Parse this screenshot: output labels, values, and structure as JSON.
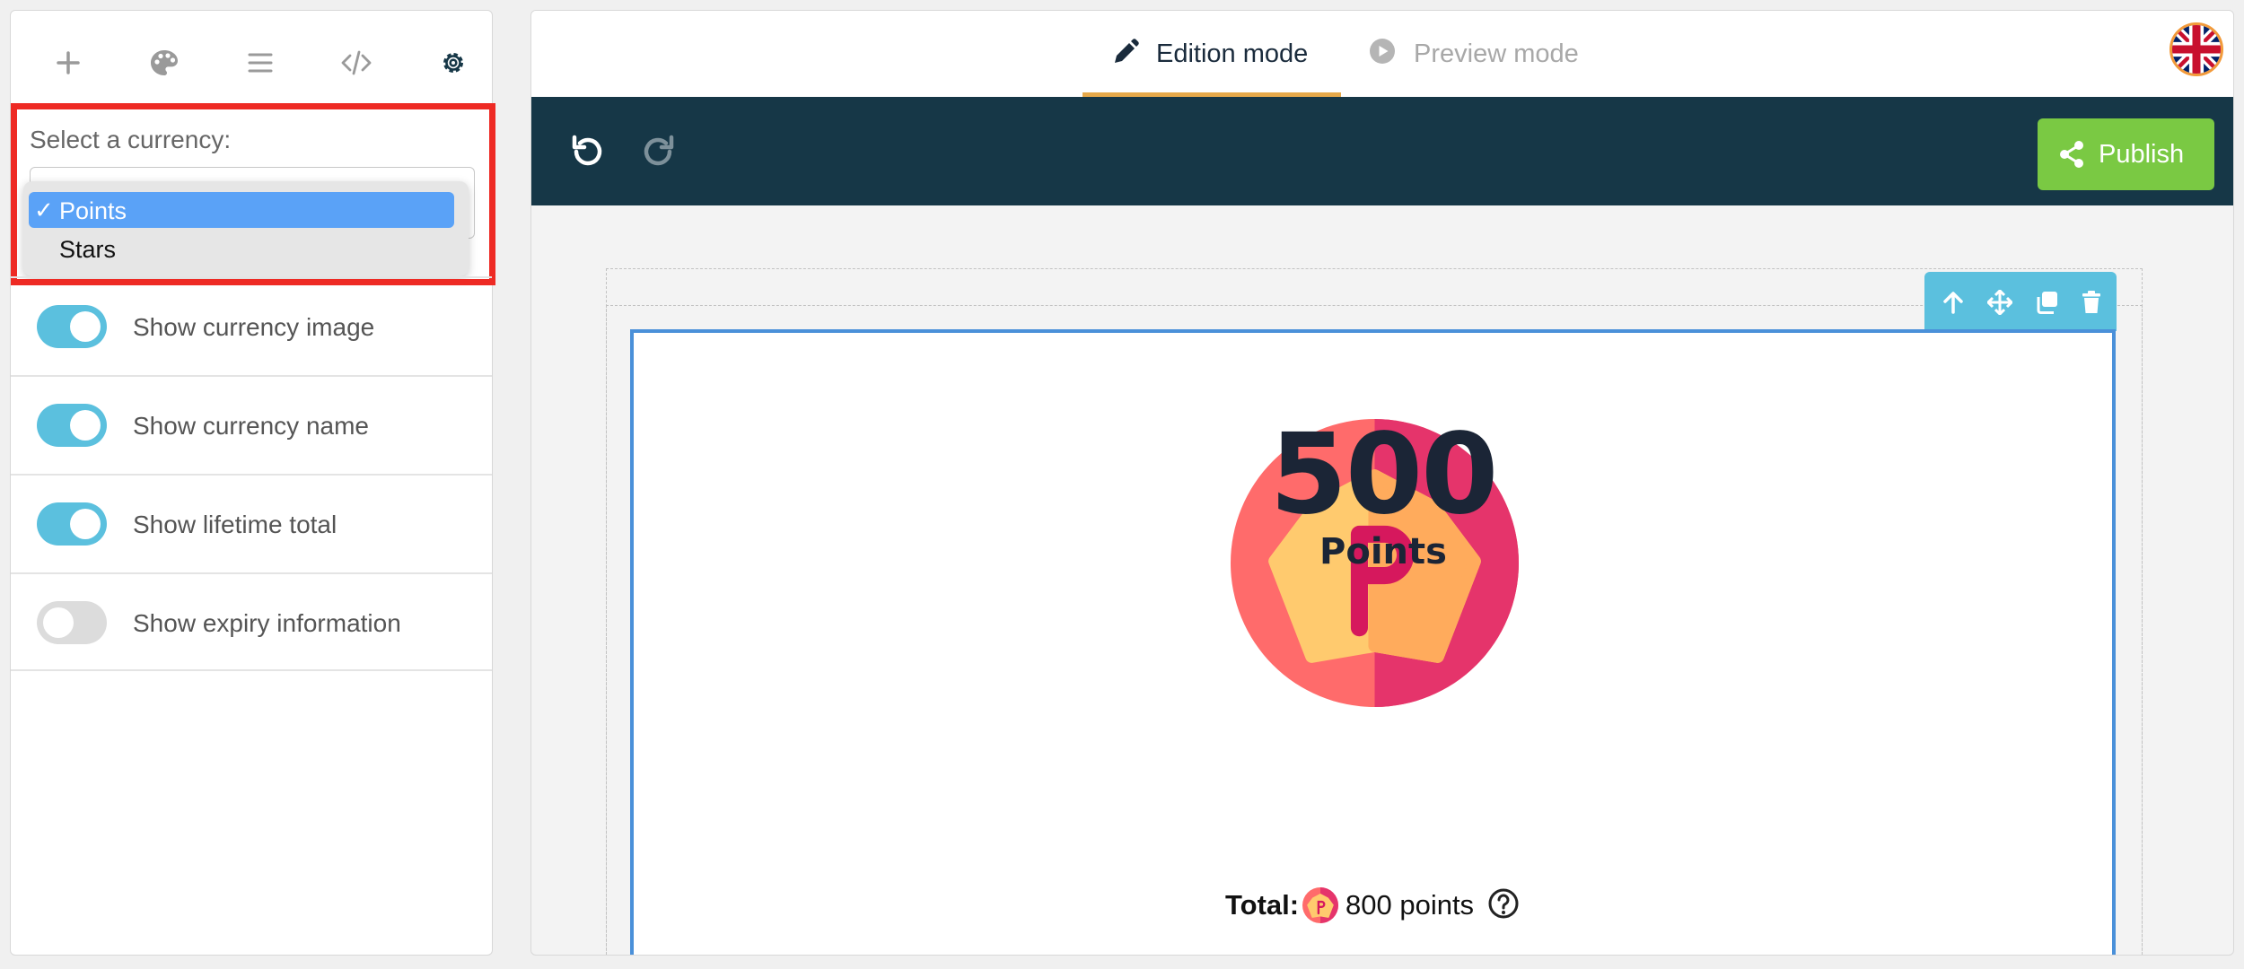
{
  "sidebar": {
    "tools": [
      {
        "icon": "plus-icon"
      },
      {
        "icon": "palette-icon"
      },
      {
        "icon": "list-icon"
      },
      {
        "icon": "code-icon"
      },
      {
        "icon": "gear-icon"
      }
    ],
    "currency_label": "Select a currency:",
    "currency_options": [
      {
        "label": "Points",
        "selected": true
      },
      {
        "label": "Stars",
        "selected": false
      }
    ],
    "toggles": [
      {
        "label": "Show currency image",
        "on": true
      },
      {
        "label": "Show currency name",
        "on": true
      },
      {
        "label": "Show lifetime total",
        "on": true
      },
      {
        "label": "Show expiry information",
        "on": false
      }
    ]
  },
  "editor": {
    "tabs": [
      {
        "label": "Edition mode",
        "active": true
      },
      {
        "label": "Preview mode",
        "active": false
      }
    ],
    "publish_label": "Publish"
  },
  "widget": {
    "balance": "500",
    "currency_name": "Points",
    "total_label": "Total:",
    "total_value": "800 points"
  },
  "colors": {
    "accent_blue": "#5bc0de",
    "header_dark": "#163747",
    "publish_green": "#7ac943",
    "highlight_red": "#ee2a24"
  }
}
